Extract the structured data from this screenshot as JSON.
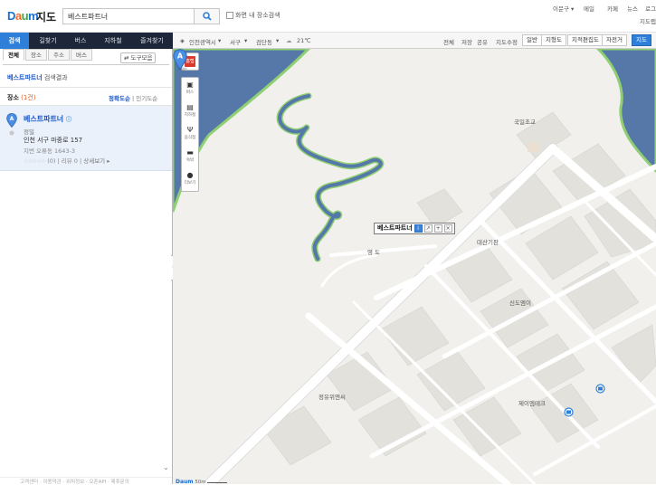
{
  "header": {
    "logo": {
      "d1": "D",
      "a": "a",
      "u": "u",
      "m": "m"
    },
    "logo_text": "지도",
    "search_value": "베스트파트너",
    "nearby_label": "화면 내 장소검색",
    "top_links": [
      "이문구 ▾",
      "메일",
      "카페",
      "뉴스",
      "로그"
    ],
    "top_links2": [
      "지도랩"
    ]
  },
  "nav": {
    "tabs": [
      "검색",
      "길찾기",
      "버스",
      "지하철",
      "즐겨찾기"
    ]
  },
  "map_toolbar": {
    "location": "인천광역시",
    "district": "서구",
    "dong": "검단동",
    "weather": "21℃",
    "links": [
      "전체",
      "저장",
      "공유",
      "지도수정"
    ],
    "view_buttons": [
      "일반",
      "지형도",
      "지적편집도",
      "자전거",
      "지도"
    ]
  },
  "sidebar": {
    "subtabs": [
      "전체",
      "장소",
      "주소",
      "버스"
    ],
    "tools_label": "도구모음",
    "result_keyword": "베스트파트너",
    "result_suffix": " 검색결과",
    "place_title": "장소",
    "place_count": "(1건)",
    "sort_accuracy": "정확도순",
    "sort_sep": " | ",
    "sort_popular": "인기도순",
    "result": {
      "marker": "A",
      "name": "베스트파트너",
      "category": "정밀",
      "address": "인천 서구 마중로 157",
      "jibun": "지번 오류동 1643-3",
      "rating_stars": "☆☆☆☆☆",
      "rating_info": "(0) | 리뷰 0 | ",
      "detail_link": "상세보기 ▸"
    },
    "footer": "고객센터 · 이용약관 · 위치정보 · 오픈API · 제휴문의"
  },
  "map_controls": {
    "red_label": "홈탭",
    "items": [
      {
        "icon": "bus-icon",
        "label": "버스"
      },
      {
        "icon": "subway-icon",
        "label": "지하철"
      },
      {
        "icon": "restaurant-icon",
        "label": "음식점"
      },
      {
        "icon": "bed-icon",
        "label": "숙박"
      },
      {
        "icon": "more-icon",
        "label": "더보기"
      }
    ]
  },
  "map_labels": {
    "school": "국일초교",
    "dong_label": "영 도",
    "daesan": "대산기판",
    "sindo": "신도엠이",
    "jaeil": "제이엠테크",
    "jeong": "정유위엔씨",
    "place_tag": "베스트파트너",
    "pin_letter": "A",
    "scale": "50m"
  },
  "colors": {
    "brand_blue": "#2e7fd9",
    "nav_bg": "#1e2739",
    "river": "#5578a8",
    "river_bank": "#8fcf73"
  }
}
